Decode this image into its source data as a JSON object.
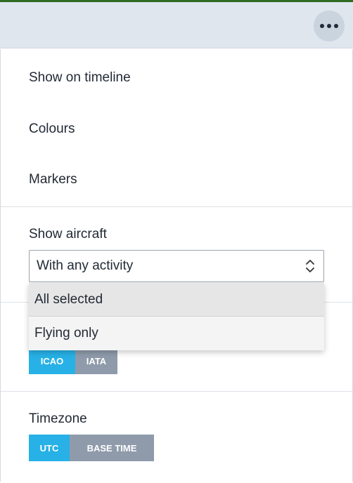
{
  "header": {
    "more_icon": "more-horizontal-icon"
  },
  "menu": {
    "items": [
      {
        "label": "Show on timeline"
      },
      {
        "label": "Colours"
      },
      {
        "label": "Markers"
      }
    ]
  },
  "show_aircraft": {
    "label": "Show aircraft",
    "selected": "With any activity",
    "options": [
      "All selected",
      "Flying only"
    ]
  },
  "airport_code": {
    "options": [
      "ICAO",
      "IATA"
    ],
    "active": "ICAO"
  },
  "timezone": {
    "label": "Timezone",
    "options": [
      "UTC",
      "BASE TIME"
    ],
    "active": "UTC"
  },
  "colors": {
    "accent_active": "#27b1e6",
    "toggle_inactive": "#8f9bab",
    "topbar": "#dfe6ee"
  }
}
